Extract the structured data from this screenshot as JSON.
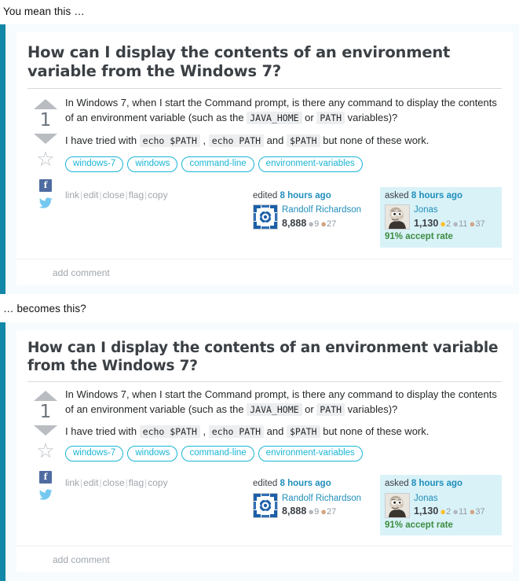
{
  "captions": {
    "before": "You mean this …",
    "after": "… becomes this?"
  },
  "question": {
    "title": "How can I display the contents of an environment variable from the Windows 7?",
    "vote_score": "1",
    "vote_up_icon": "arrow-up-icon",
    "vote_down_icon": "arrow-down-icon",
    "favorite_icon": "star-icon",
    "share_facebook_icon": "facebook-icon",
    "share_facebook_label": "f",
    "share_twitter_icon": "twitter-icon",
    "body": {
      "p1_a": "In Windows 7, when I start the Command prompt, is there any command to display the contents of an environment variable (such as the ",
      "p1_code1": "JAVA_HOME",
      "p1_b": " or ",
      "p1_code2": "PATH",
      "p1_c": " variables)?",
      "p2_a": "I have tried with ",
      "p2_code1": "echo $PATH",
      "p2_b": " , ",
      "p2_code2": "echo PATH",
      "p2_c": " and ",
      "p2_code3": "$PATH",
      "p2_d": " but none of these work."
    },
    "tags": [
      "windows-7",
      "windows",
      "command-line",
      "environment-variables"
    ],
    "actions": [
      "link",
      "edit",
      "close",
      "flag",
      "copy"
    ],
    "action_separator": "|",
    "editor": {
      "action_label": "edited",
      "time": "8 hours ago",
      "name": "Randolf Richardson",
      "reputation": "8,888",
      "badges": {
        "silver": "9",
        "bronze": "27"
      },
      "avatar_icon": "identicon-avatar"
    },
    "asker": {
      "action_label": "asked",
      "time": "8 hours ago",
      "name": "Jonas",
      "reputation": "1,130",
      "badges": {
        "gold": "2",
        "silver": "11",
        "bronze": "37"
      },
      "accept_rate": "91% accept rate",
      "avatar_icon": "cartoon-face-avatar"
    },
    "add_comment": "add comment"
  },
  "colors": {
    "accent_bar": "#1287a8",
    "card_background": "#f6fcfd",
    "tag_border": "#19b5d4",
    "link": "#1f8ebb",
    "asker_card_background": "#d9f2f8",
    "accept_rate": "#3d8c40",
    "code_background": "#eceef0"
  }
}
